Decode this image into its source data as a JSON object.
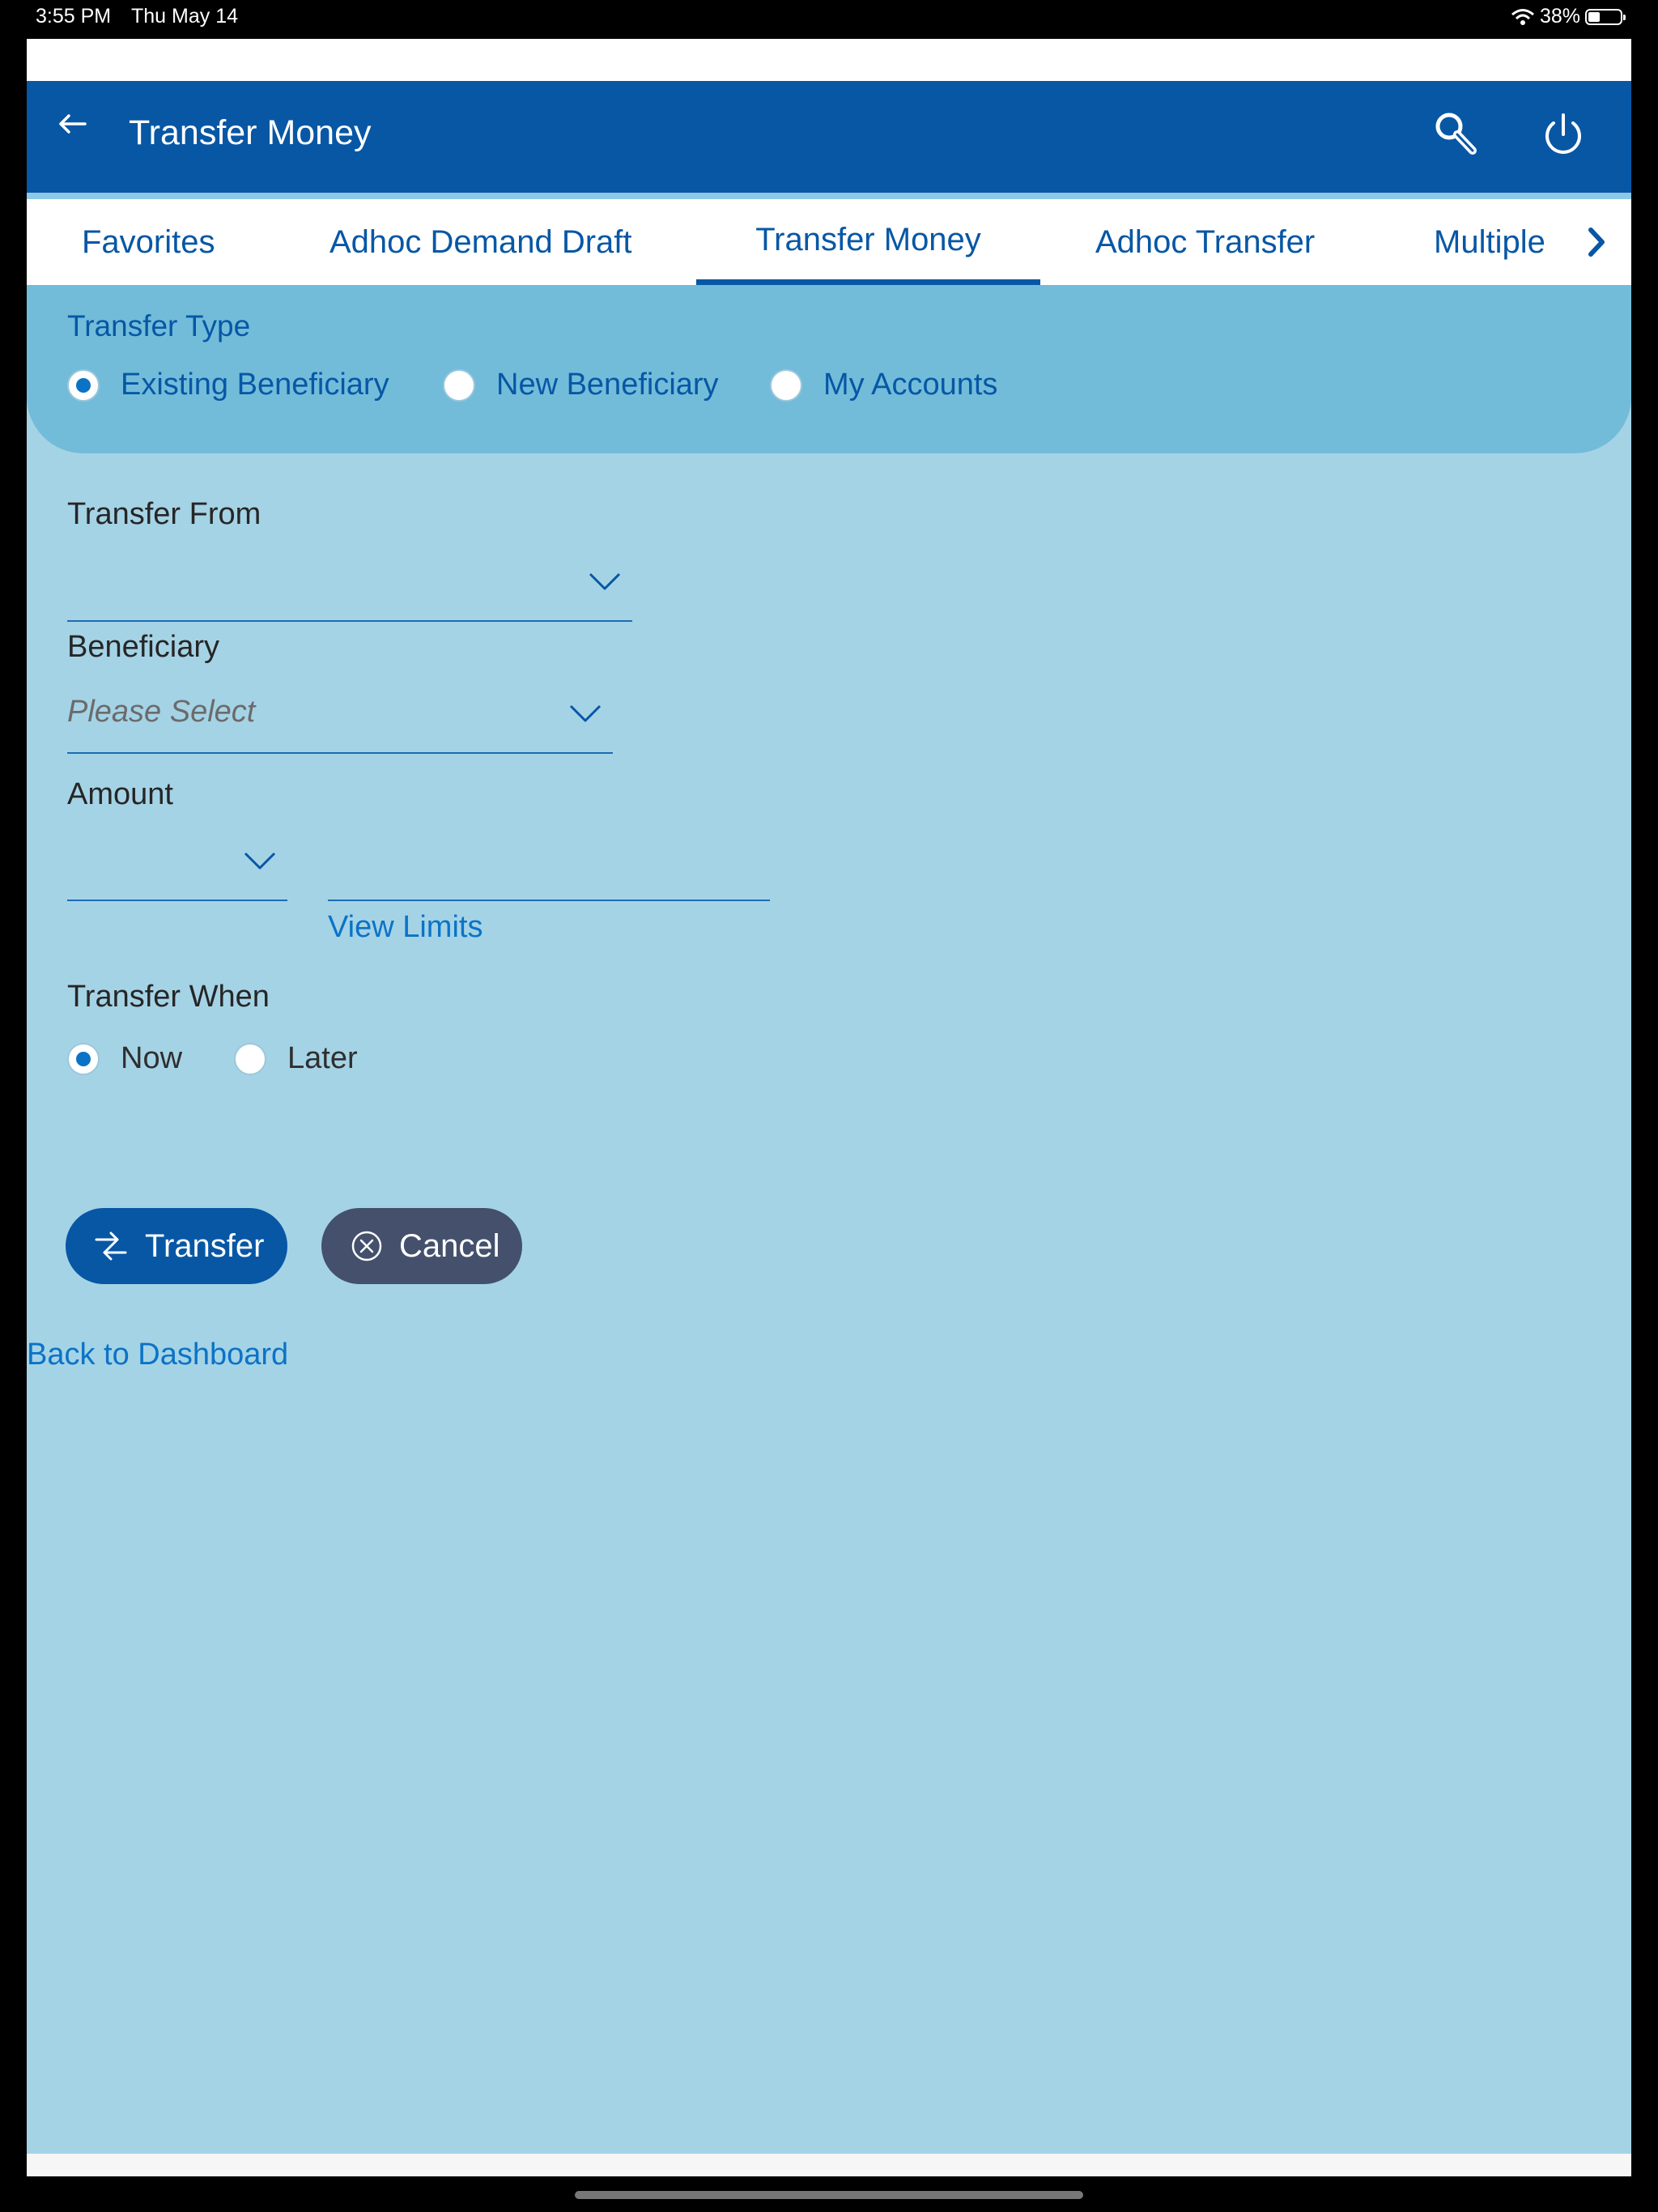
{
  "status_bar": {
    "time": "3:55 PM",
    "date": "Thu May 14",
    "battery": "38%"
  },
  "header": {
    "title": "Transfer Money"
  },
  "tabs": [
    {
      "label": "Favorites"
    },
    {
      "label": "Adhoc Demand Draft"
    },
    {
      "label": "Transfer Money"
    },
    {
      "label": "Adhoc Transfer"
    },
    {
      "label": "Multiple"
    }
  ],
  "active_tab": "Transfer Money",
  "transfer_type": {
    "title": "Transfer Type",
    "options": [
      {
        "label": "Existing Beneficiary",
        "selected": true
      },
      {
        "label": "New Beneficiary",
        "selected": false
      },
      {
        "label": "My Accounts",
        "selected": false
      }
    ]
  },
  "form": {
    "transfer_from": {
      "label": "Transfer From",
      "value": ""
    },
    "beneficiary": {
      "label": "Beneficiary",
      "placeholder": "Please Select"
    },
    "amount": {
      "label": "Amount",
      "currency": "",
      "value": "",
      "view_limits": "View Limits"
    },
    "transfer_when": {
      "label": "Transfer When",
      "options": [
        {
          "label": "Now",
          "selected": true
        },
        {
          "label": "Later",
          "selected": false
        }
      ]
    }
  },
  "actions": {
    "transfer": "Transfer",
    "cancel": "Cancel"
  },
  "back_link": "Back to Dashboard",
  "colors": {
    "primary": "#0757a5",
    "background": "#a5d3e6",
    "panel": "#72bcda",
    "link": "#0b73c6",
    "cancel": "#44506c"
  }
}
